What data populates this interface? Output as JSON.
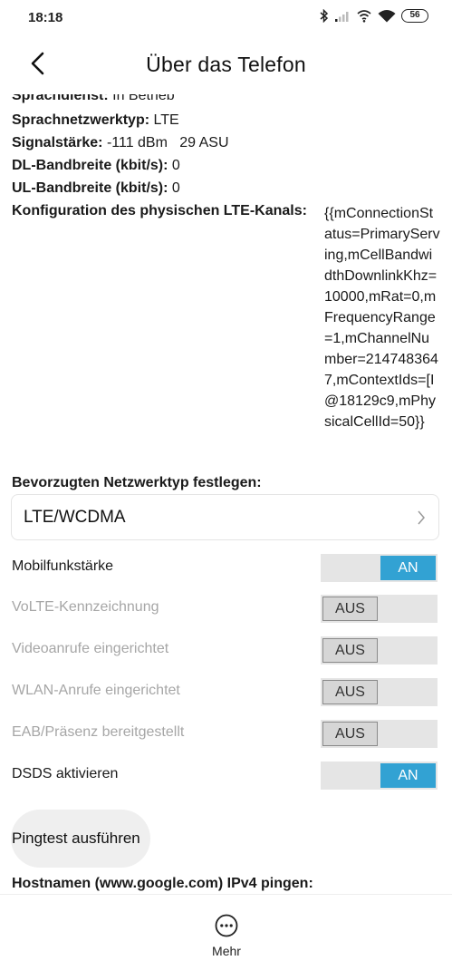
{
  "status_bar": {
    "time": "18:18",
    "battery": "56",
    "icons": [
      "bluetooth-icon",
      "signal-icon",
      "hotspot-icon",
      "wifi-icon",
      "battery-icon"
    ]
  },
  "header": {
    "title": "Über das Telefon",
    "back_icon": "back-arrow-icon"
  },
  "info": {
    "voice_service": {
      "label": "Sprachdienst:",
      "value": "In Betrieb"
    },
    "voice_network_type": {
      "label": "Sprachnetzwerktyp:",
      "value": "LTE"
    },
    "signal_strength": {
      "label": "Signalstärke:",
      "value": "-111 dBm   29 ASU"
    },
    "dl_bandwidth": {
      "label": "DL-Bandbreite (kbit/s):",
      "value": "0"
    },
    "ul_bandwidth": {
      "label": "UL-Bandbreite (kbit/s):",
      "value": "0"
    },
    "lte_channel_config": {
      "label": "Konfiguration des physischen LTE-Kanals:",
      "value": "{{mConnectionStatus=PrimaryServing,mCellBandwidthDownlinkKhz=10000,mRat=0,mFrequencyRange=1,mChannelNumber=2147483647,mContextIds=[I@18129c9,mPhysicalCellId=50}}"
    }
  },
  "preferred_network": {
    "label": "Bevorzugten Netzwerktyp festlegen:",
    "selected": "LTE/WCDMA"
  },
  "toggles": [
    {
      "label": "Mobilfunkstärke",
      "state": "AN",
      "enabled": true
    },
    {
      "label": "VoLTE-Kennzeichnung",
      "state": "AUS",
      "enabled": false
    },
    {
      "label": "Videoanrufe eingerichtet",
      "state": "AUS",
      "enabled": false
    },
    {
      "label": "WLAN-Anrufe eingerichtet",
      "state": "AUS",
      "enabled": false
    },
    {
      "label": "EAB/Präsenz bereitgestellt",
      "state": "AUS",
      "enabled": false
    },
    {
      "label": "DSDS aktivieren",
      "state": "AN",
      "enabled": true
    }
  ],
  "ping": {
    "button_label": "Pingtest ausführen",
    "hostname_label": "Hostnamen (www.google.com) IPv4 pingen:"
  },
  "bottom_bar": {
    "more_label": "Mehr",
    "more_icon": "more-icon"
  },
  "colors": {
    "toggle_on": "#32a2d3",
    "toggle_track": "#e5e5e5",
    "disabled_text": "#a6a6a6"
  }
}
